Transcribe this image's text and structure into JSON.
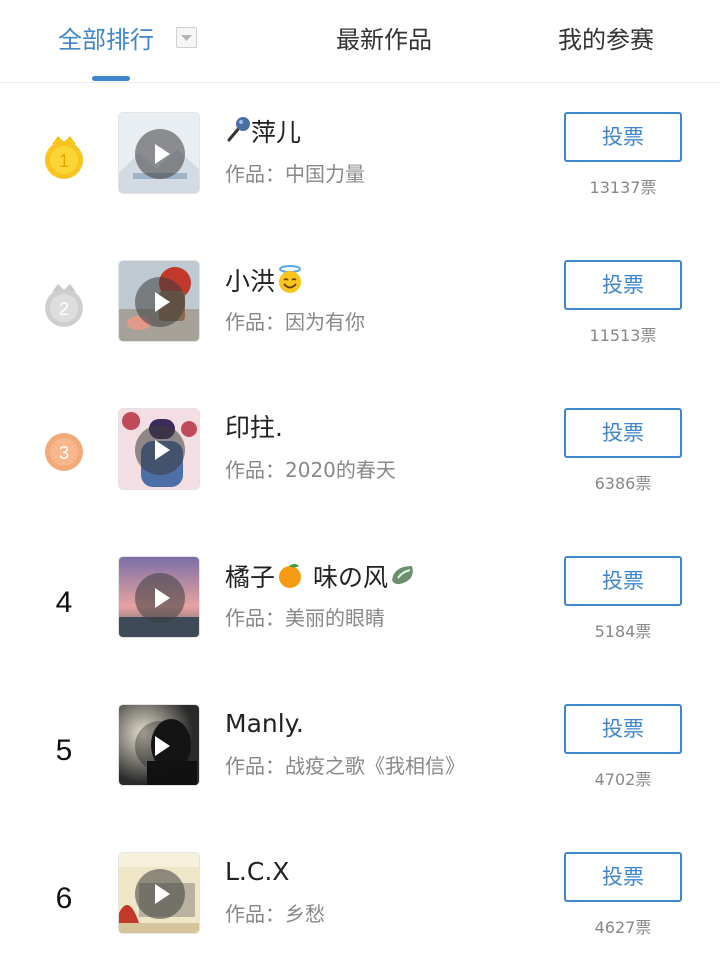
{
  "tabs": {
    "all": "全部排行",
    "new": "最新作品",
    "mine": "我的参赛"
  },
  "colors": {
    "accent": "#3f86cc",
    "gold": "#f7c51e",
    "silver": "#c9c9c9",
    "bronze": "#f4a97a"
  },
  "vote_label": "投票",
  "entries": [
    {
      "rank": "1",
      "name": "萍儿",
      "name_prefix_icon": "microphone-icon",
      "work": "作品：中国力量",
      "votes": "13137票"
    },
    {
      "rank": "2",
      "name": "小洪",
      "name_suffix_icon": "halo-smile-icon",
      "work": "作品：因为有你",
      "votes": "11513票"
    },
    {
      "rank": "3",
      "name": "印拄.",
      "work": "作品：2020的春天",
      "votes": "6386票"
    },
    {
      "rank": "4",
      "name_a": "橘子",
      "name_b": "味の风",
      "name_icons": [
        "tangerine-icon",
        "leaf-swirl-icon"
      ],
      "work": "作品：美丽的眼睛",
      "votes": "5184票"
    },
    {
      "rank": "5",
      "name": "Manly.",
      "work": "作品：战疫之歌《我相信》",
      "votes": "4702票"
    },
    {
      "rank": "6",
      "name": "L.C.X",
      "work": "作品：乡愁",
      "votes": "4627票"
    }
  ]
}
